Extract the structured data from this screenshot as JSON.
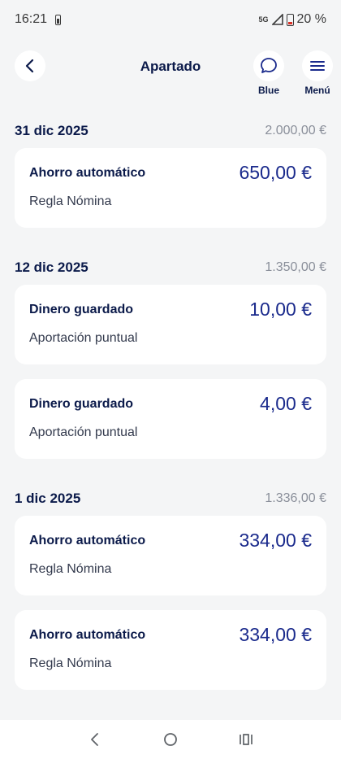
{
  "status": {
    "time": "16:21",
    "network": "5G",
    "battery": "20 %"
  },
  "header": {
    "title": "Apartado",
    "blue_label": "Blue",
    "menu_label": "Menú"
  },
  "groups": [
    {
      "date": "31 dic 2025",
      "total": "2.000,00 €",
      "items": [
        {
          "title": "Ahorro automático",
          "subtitle": "Regla Nómina",
          "amount": "650,00 €"
        }
      ]
    },
    {
      "date": "12 dic 2025",
      "total": "1.350,00 €",
      "items": [
        {
          "title": "Dinero guardado",
          "subtitle": "Aportación puntual",
          "amount": "10,00 €"
        },
        {
          "title": "Dinero guardado",
          "subtitle": "Aportación puntual",
          "amount": "4,00 €"
        }
      ]
    },
    {
      "date": "1 dic 2025",
      "total": "1.336,00 €",
      "items": [
        {
          "title": "Ahorro automático",
          "subtitle": "Regla Nómina",
          "amount": "334,00 €"
        },
        {
          "title": "Ahorro automático",
          "subtitle": "Regla Nómina",
          "amount": "334,00 €"
        }
      ]
    }
  ],
  "colors": {
    "background": "#f4f5f6",
    "card": "#ffffff",
    "text_primary": "#0b1a4a",
    "amount": "#1a2a8c",
    "muted": "#8a8f9a"
  },
  "icons": {
    "back": "chevron-left-icon",
    "blue": "chat-bubble-icon",
    "menu": "hamburger-menu-icon",
    "nav_back": "chevron-left-icon",
    "nav_home": "circle-home-icon",
    "nav_recents": "recents-icon"
  }
}
